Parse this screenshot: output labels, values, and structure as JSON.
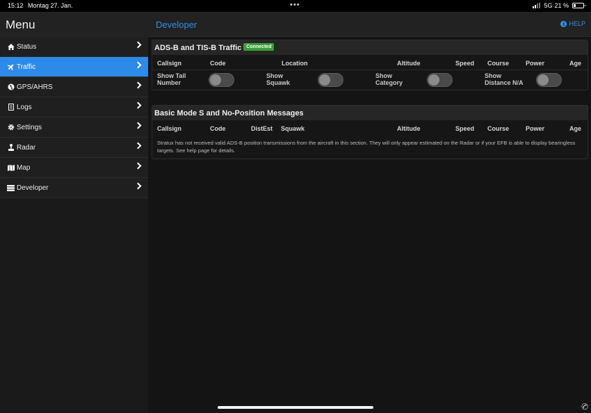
{
  "status_bar": {
    "time": "15:12",
    "date": "Montag 27. Jan.",
    "network": "5G",
    "battery": "21 %"
  },
  "sidebar": {
    "title": "Menu",
    "items": [
      {
        "label": "Status",
        "icon": "home-icon"
      },
      {
        "label": "Traffic",
        "icon": "plane-icon",
        "active": true
      },
      {
        "label": "GPS/AHRS",
        "icon": "globe-icon"
      },
      {
        "label": "Logs",
        "icon": "document-icon"
      },
      {
        "label": "Settings",
        "icon": "gear-icon"
      },
      {
        "label": "Radar",
        "icon": "joystick-icon"
      },
      {
        "label": "Map",
        "icon": "map-icon"
      },
      {
        "label": "Developer",
        "icon": "server-icon"
      }
    ]
  },
  "header": {
    "title": "Developer",
    "help_label": "HELP"
  },
  "traffic_panel": {
    "title": "ADS-B and TIS-B Traffic",
    "badge": "Connected",
    "columns": [
      "Callsign",
      "Code",
      "Location",
      "Altitude",
      "Speed",
      "Course",
      "Power",
      "Age"
    ],
    "toggles": [
      {
        "label_line1": "Show Tail",
        "label_line2": "Number",
        "checked": false
      },
      {
        "label_line1": "Show",
        "label_line2": "Squawk",
        "checked": false
      },
      {
        "label_line1": "Show",
        "label_line2": "Category",
        "checked": false
      },
      {
        "label_line1": "Show",
        "label_line2": "Distance N/A",
        "checked": false
      }
    ]
  },
  "modes_panel": {
    "title": "Basic Mode S and No-Position Messages",
    "columns": [
      "Callsign",
      "Code",
      "DistEst",
      "Squawk",
      "Altitude",
      "Speed",
      "Course",
      "Power",
      "Age"
    ],
    "note": "Stratux has not received valid ADS-B position transmissions from the aircraft in this section. They will only appear estimated on the Radar or if your EFB is able to display bearingless targets. See help page for details."
  },
  "colors": {
    "accent": "#2d8ae8",
    "connected": "#3a9d3a",
    "background": "#141414"
  }
}
